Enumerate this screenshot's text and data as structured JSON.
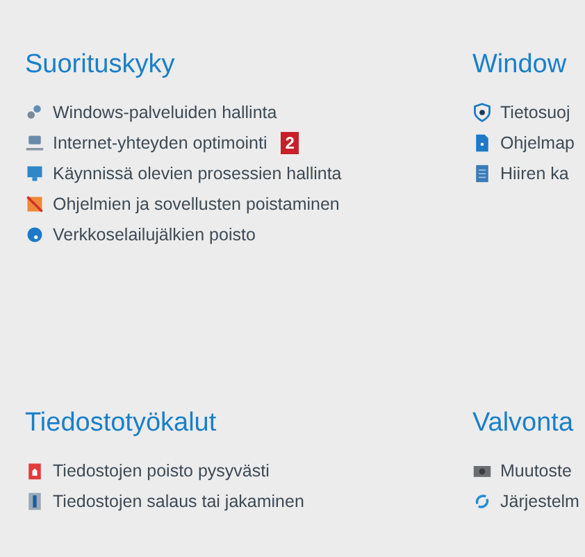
{
  "sections": [
    {
      "title": "Suorituskyky",
      "items": [
        {
          "label": "Windows-palveluiden hallinta"
        },
        {
          "label": "Internet-yhteyden optimointi",
          "badge": "2"
        },
        {
          "label": "Käynnissä olevien prosessien hallinta"
        },
        {
          "label": "Ohjelmien ja sovellusten poistaminen"
        },
        {
          "label": "Verkkoselailujälkien poisto"
        }
      ]
    },
    {
      "title": "Window",
      "items": [
        {
          "label": "Tietosuoj"
        },
        {
          "label": "Ohjelmap"
        },
        {
          "label": "Hiiren ka"
        }
      ]
    },
    {
      "title": "Tiedostotyökalut",
      "items": [
        {
          "label": "Tiedostojen poisto pysyvästi"
        },
        {
          "label": "Tiedostojen salaus tai jakaminen"
        }
      ]
    },
    {
      "title": "Valvonta",
      "items": [
        {
          "label": "Muutoste"
        },
        {
          "label": "Järjestelm"
        }
      ]
    }
  ]
}
